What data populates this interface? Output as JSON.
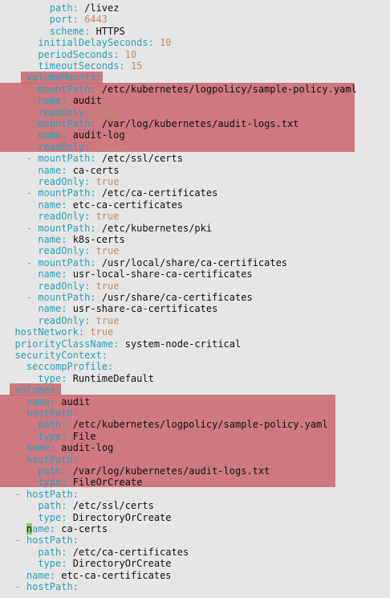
{
  "editor": {
    "lines": [
      {
        "indent": 8,
        "dash": false,
        "key": "path",
        "value": "/livez",
        "type": "str"
      },
      {
        "indent": 8,
        "dash": false,
        "key": "port",
        "value": "6443",
        "type": "num"
      },
      {
        "indent": 8,
        "dash": false,
        "key": "scheme",
        "value": "HTTPS",
        "type": "str"
      },
      {
        "indent": 6,
        "dash": false,
        "key": "initialDelaySeconds",
        "value": "10",
        "type": "num"
      },
      {
        "indent": 6,
        "dash": false,
        "key": "periodSeconds",
        "value": "10",
        "type": "num"
      },
      {
        "indent": 6,
        "dash": false,
        "key": "timeoutSeconds",
        "value": "15",
        "type": "num"
      },
      {
        "indent": 4,
        "dash": false,
        "key": "volumeMounts",
        "value": "",
        "type": "str"
      },
      {
        "indent": 4,
        "dash": true,
        "key": "mountPath",
        "value": "/etc/kubernetes/logpolicy/sample-policy.yaml",
        "type": "str"
      },
      {
        "indent": 6,
        "dash": false,
        "key": "name",
        "value": "audit",
        "type": "str"
      },
      {
        "indent": 6,
        "dash": false,
        "key": "readOnly",
        "value": "true",
        "type": "bool"
      },
      {
        "indent": 4,
        "dash": true,
        "key": "mountPath",
        "value": "/var/log/kubernetes/audit-logs.txt",
        "type": "str"
      },
      {
        "indent": 6,
        "dash": false,
        "key": "name",
        "value": "audit-log",
        "type": "str"
      },
      {
        "indent": 6,
        "dash": false,
        "key": "readOnly",
        "value": "false",
        "type": "bool"
      },
      {
        "indent": 4,
        "dash": true,
        "key": "mountPath",
        "value": "/etc/ssl/certs",
        "type": "str"
      },
      {
        "indent": 6,
        "dash": false,
        "key": "name",
        "value": "ca-certs",
        "type": "str"
      },
      {
        "indent": 6,
        "dash": false,
        "key": "readOnly",
        "value": "true",
        "type": "bool"
      },
      {
        "indent": 4,
        "dash": true,
        "key": "mountPath",
        "value": "/etc/ca-certificates",
        "type": "str"
      },
      {
        "indent": 6,
        "dash": false,
        "key": "name",
        "value": "etc-ca-certificates",
        "type": "str"
      },
      {
        "indent": 6,
        "dash": false,
        "key": "readOnly",
        "value": "true",
        "type": "bool"
      },
      {
        "indent": 4,
        "dash": true,
        "key": "mountPath",
        "value": "/etc/kubernetes/pki",
        "type": "str"
      },
      {
        "indent": 6,
        "dash": false,
        "key": "name",
        "value": "k8s-certs",
        "type": "str"
      },
      {
        "indent": 6,
        "dash": false,
        "key": "readOnly",
        "value": "true",
        "type": "bool"
      },
      {
        "indent": 4,
        "dash": true,
        "key": "mountPath",
        "value": "/usr/local/share/ca-certificates",
        "type": "str"
      },
      {
        "indent": 6,
        "dash": false,
        "key": "name",
        "value": "usr-local-share-ca-certificates",
        "type": "str"
      },
      {
        "indent": 6,
        "dash": false,
        "key": "readOnly",
        "value": "true",
        "type": "bool"
      },
      {
        "indent": 4,
        "dash": true,
        "key": "mountPath",
        "value": "/usr/share/ca-certificates",
        "type": "str"
      },
      {
        "indent": 6,
        "dash": false,
        "key": "name",
        "value": "usr-share-ca-certificates",
        "type": "str"
      },
      {
        "indent": 6,
        "dash": false,
        "key": "readOnly",
        "value": "true",
        "type": "bool"
      },
      {
        "indent": 2,
        "dash": false,
        "key": "hostNetwork",
        "value": "true",
        "type": "bool"
      },
      {
        "indent": 2,
        "dash": false,
        "key": "priorityClassName",
        "value": "system-node-critical",
        "type": "str"
      },
      {
        "indent": 2,
        "dash": false,
        "key": "securityContext",
        "value": "",
        "type": "str"
      },
      {
        "indent": 4,
        "dash": false,
        "key": "seccompProfile",
        "value": "",
        "type": "str"
      },
      {
        "indent": 6,
        "dash": false,
        "key": "type",
        "value": "RuntimeDefault",
        "type": "str"
      },
      {
        "indent": 2,
        "dash": false,
        "key": "volumes",
        "value": "",
        "type": "str"
      },
      {
        "indent": 2,
        "dash": true,
        "key": "name",
        "value": "audit",
        "type": "str"
      },
      {
        "indent": 4,
        "dash": false,
        "key": "hostPath",
        "value": "",
        "type": "str"
      },
      {
        "indent": 6,
        "dash": false,
        "key": "path",
        "value": "/etc/kubernetes/logpolicy/sample-policy.yaml",
        "type": "str"
      },
      {
        "indent": 6,
        "dash": false,
        "key": "type",
        "value": "File",
        "type": "str"
      },
      {
        "indent": 2,
        "dash": true,
        "key": "name",
        "value": "audit-log",
        "type": "str"
      },
      {
        "indent": 4,
        "dash": false,
        "key": "hostPath",
        "value": "",
        "type": "str"
      },
      {
        "indent": 6,
        "dash": false,
        "key": "path",
        "value": "/var/log/kubernetes/audit-logs.txt",
        "type": "str"
      },
      {
        "indent": 6,
        "dash": false,
        "key": "type",
        "value": "FileOrCreate",
        "type": "str"
      },
      {
        "indent": 2,
        "dash": true,
        "key": "hostPath",
        "value": "",
        "type": "str"
      },
      {
        "indent": 6,
        "dash": false,
        "key": "path",
        "value": "/etc/ssl/certs",
        "type": "str"
      },
      {
        "indent": 6,
        "dash": false,
        "key": "type",
        "value": "DirectoryOrCreate",
        "type": "str"
      },
      {
        "indent": 4,
        "dash": false,
        "key": "name",
        "value": "ca-certs",
        "type": "str",
        "cursor": true
      },
      {
        "indent": 2,
        "dash": true,
        "key": "hostPath",
        "value": "",
        "type": "str"
      },
      {
        "indent": 6,
        "dash": false,
        "key": "path",
        "value": "/etc/ca-certificates",
        "type": "str"
      },
      {
        "indent": 6,
        "dash": false,
        "key": "type",
        "value": "DirectoryOrCreate",
        "type": "str"
      },
      {
        "indent": 4,
        "dash": false,
        "key": "name",
        "value": "etc-ca-certificates",
        "type": "str"
      },
      {
        "indent": 2,
        "dash": true,
        "key": "hostPath",
        "value": "",
        "type": "str"
      }
    ]
  },
  "colors": {
    "background": "#e6e6e6",
    "key": "#2a9fb5",
    "scalar": "#c08c66",
    "text": "#111111",
    "highlight": "#c9646e",
    "cursor": "#87d06a"
  }
}
